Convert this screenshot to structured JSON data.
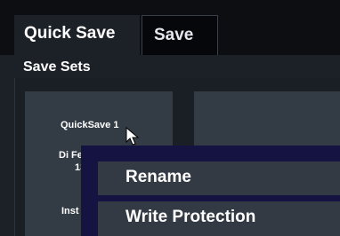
{
  "tabs": [
    {
      "label": "Quick Save"
    },
    {
      "label": "Save"
    }
  ],
  "section_title": "Save Sets",
  "save_set_card": {
    "name": "QuickSave 1",
    "date": "Di Fe",
    "time": "13",
    "instrument": "Inst"
  },
  "context_menu": {
    "items": [
      {
        "label": "Rename"
      },
      {
        "label": "Write Protection"
      }
    ]
  },
  "colors": {
    "background": "#1c2128",
    "card": "#333b44",
    "menu_border": "#151342",
    "menu_item": "#333a44"
  }
}
